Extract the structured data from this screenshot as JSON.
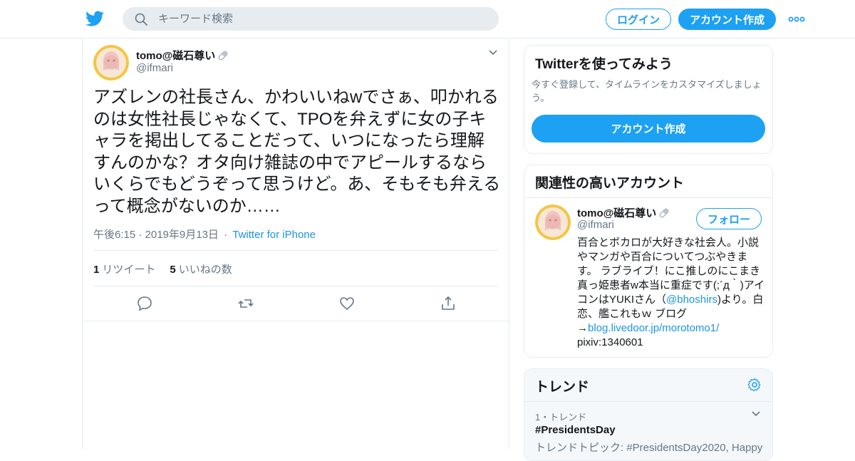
{
  "colors": {
    "accent": "#1da1f2",
    "link": "#1b95e0",
    "text": "#14171a",
    "muted": "#657786",
    "border": "#e6ecf0"
  },
  "header": {
    "logo_icon": "twitter-bird-icon",
    "search_placeholder": "キーワード検索",
    "login_label": "ログイン",
    "signup_label": "アカウント作成",
    "more_icon": "more-dots-icon"
  },
  "tweet": {
    "author_name": "tomo@磁石尊い",
    "author_name_emoji": "pill-icon",
    "author_handle": "@ifmari",
    "text": "アズレンの社長さん、かわいいねwでさぁ、叩かれるのは女性社長じゃなくて、TPOを弁えずに女の子キャラを掲出してることだって、いつになったら理解すんのかな？オタ向け雑誌の中でアピールするならいくらでもどうぞって思うけど。あ、そもそも弁えるって概念がないのか……",
    "time": "午後6:15 · 2019年9月13日",
    "source": "Twitter for iPhone",
    "retweets_count": "1",
    "retweets_label": "リツイート",
    "likes_count": "5",
    "likes_label": "いいねの数"
  },
  "signup_card": {
    "title": "Twitterを使ってみよう",
    "subtitle": "今すぐ登録して、タイムラインをカスタマイズしましょう。",
    "button_label": "アカウント作成"
  },
  "related_card": {
    "title": "関連性の高いアカウント",
    "name": "tomo@磁石尊い",
    "handle": "@ifmari",
    "follow_label": "フォロー",
    "bio_part1": "百合とボカロが大好きな社会人。小説やマンガや百合についてつぶやきます。 ラブライブ！にこ推しのにこまき真っ姫患者w本当に重症です(;´д｀)アイコンはYUKIさん（",
    "bio_mention": "@bhoshirs",
    "bio_part2": ")より。白恋、艦これもｗ ブログ→",
    "bio_link": "blog.livedoor.jp/morotomo1/",
    "bio_part3": " pixiv:1340601"
  },
  "trends_card": {
    "title": "トレンド",
    "rank": "1・トレンド",
    "tag": "#PresidentsDay",
    "topic": "トレンドトピック: #PresidentsDay2020, Happy"
  }
}
